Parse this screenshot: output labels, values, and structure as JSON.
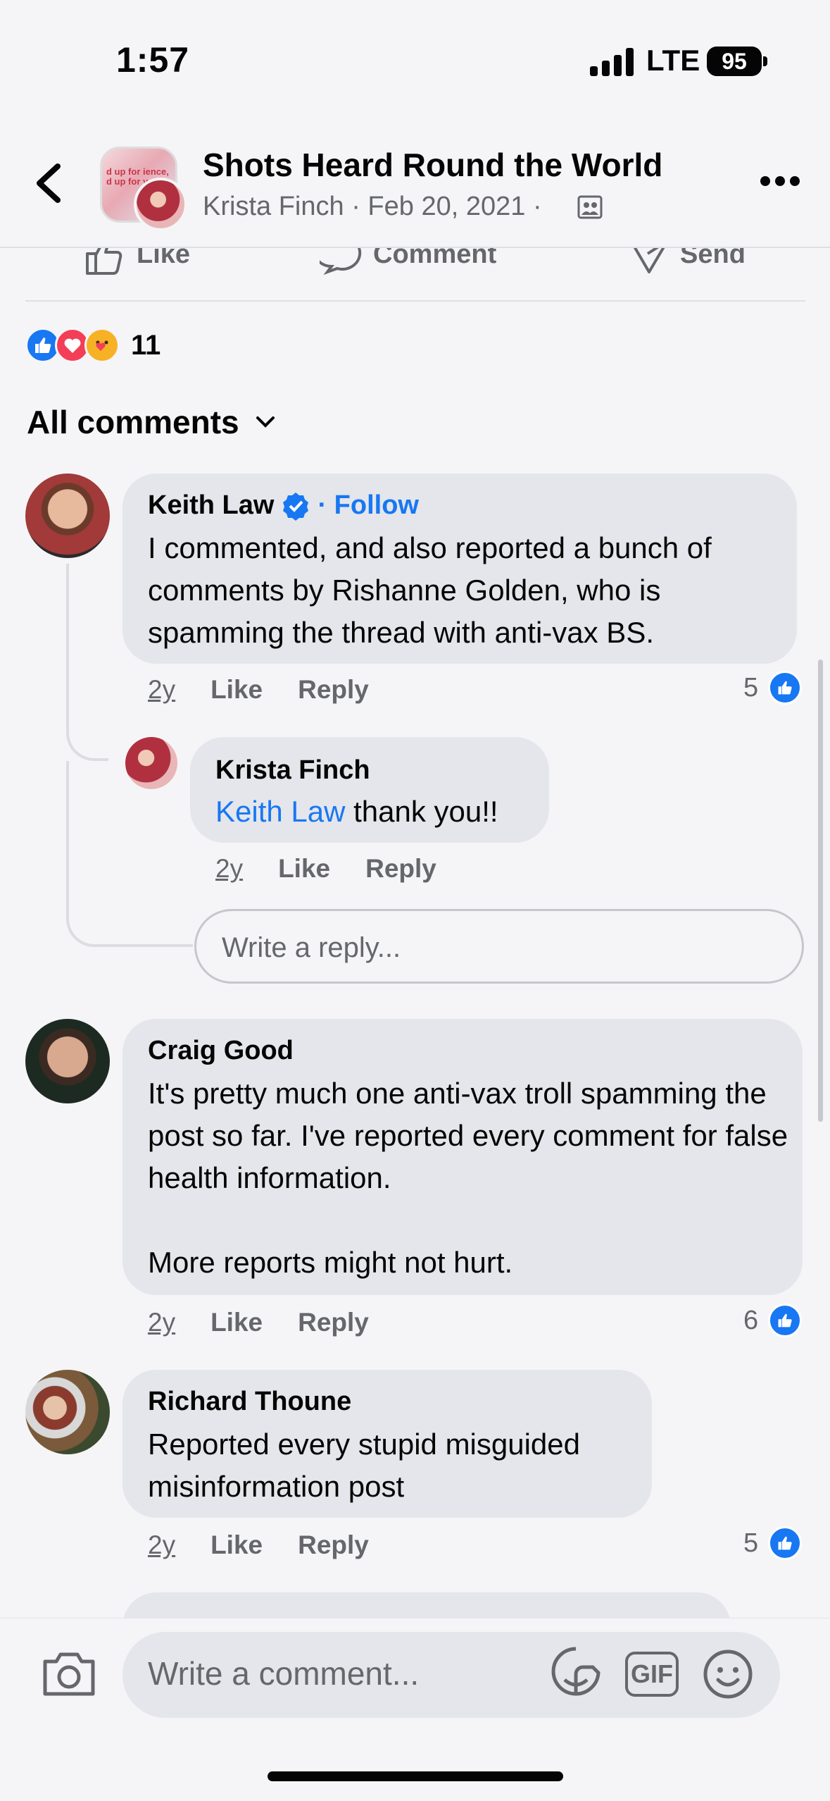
{
  "status_bar": {
    "time": "1:57",
    "network": "LTE",
    "battery": "95"
  },
  "header": {
    "title": "Shots Heard Round the World",
    "author": "Krista Finch",
    "date": "Feb 20, 2021",
    "separator": "·",
    "avatar_snippet": "d up for ience, d up for you"
  },
  "actions": {
    "like": "Like",
    "comment": "Comment",
    "send": "Send"
  },
  "reactions": {
    "count": "11",
    "types": [
      "like",
      "love",
      "care"
    ]
  },
  "comments_header": "All comments",
  "comments": [
    {
      "name": "Keith Law",
      "verified": true,
      "follow": "· Follow",
      "text": "I commented, and also reported a bunch of comments by Rishanne Golden, who is spamming the thread with anti-vax BS.",
      "age": "2y",
      "like": "Like",
      "reply": "Reply",
      "likes": "5"
    },
    {
      "name": "Krista Finch",
      "mention": "Keith Law",
      "text": " thank you!!",
      "age": "2y",
      "like": "Like",
      "reply": "Reply"
    },
    {
      "name": "Craig Good",
      "text": "It's pretty much one anti-vax troll spamming the post so far. I've reported every comment for false health information.",
      "text2": "More reports might not hurt.",
      "age": "2y",
      "like": "Like",
      "reply": "Reply",
      "likes": "6"
    },
    {
      "name": "Richard Thoune",
      "text": "Reported every stupid misguided misinformation post",
      "age": "2y",
      "like": "Like",
      "reply": "Reply",
      "likes": "5"
    }
  ],
  "reply_placeholder": "Write a reply...",
  "composer": {
    "placeholder": "Write a comment...",
    "gif": "GIF"
  },
  "colors": {
    "accent": "#1877f2",
    "bubble": "#e4e6eb",
    "muted": "#65676b"
  }
}
